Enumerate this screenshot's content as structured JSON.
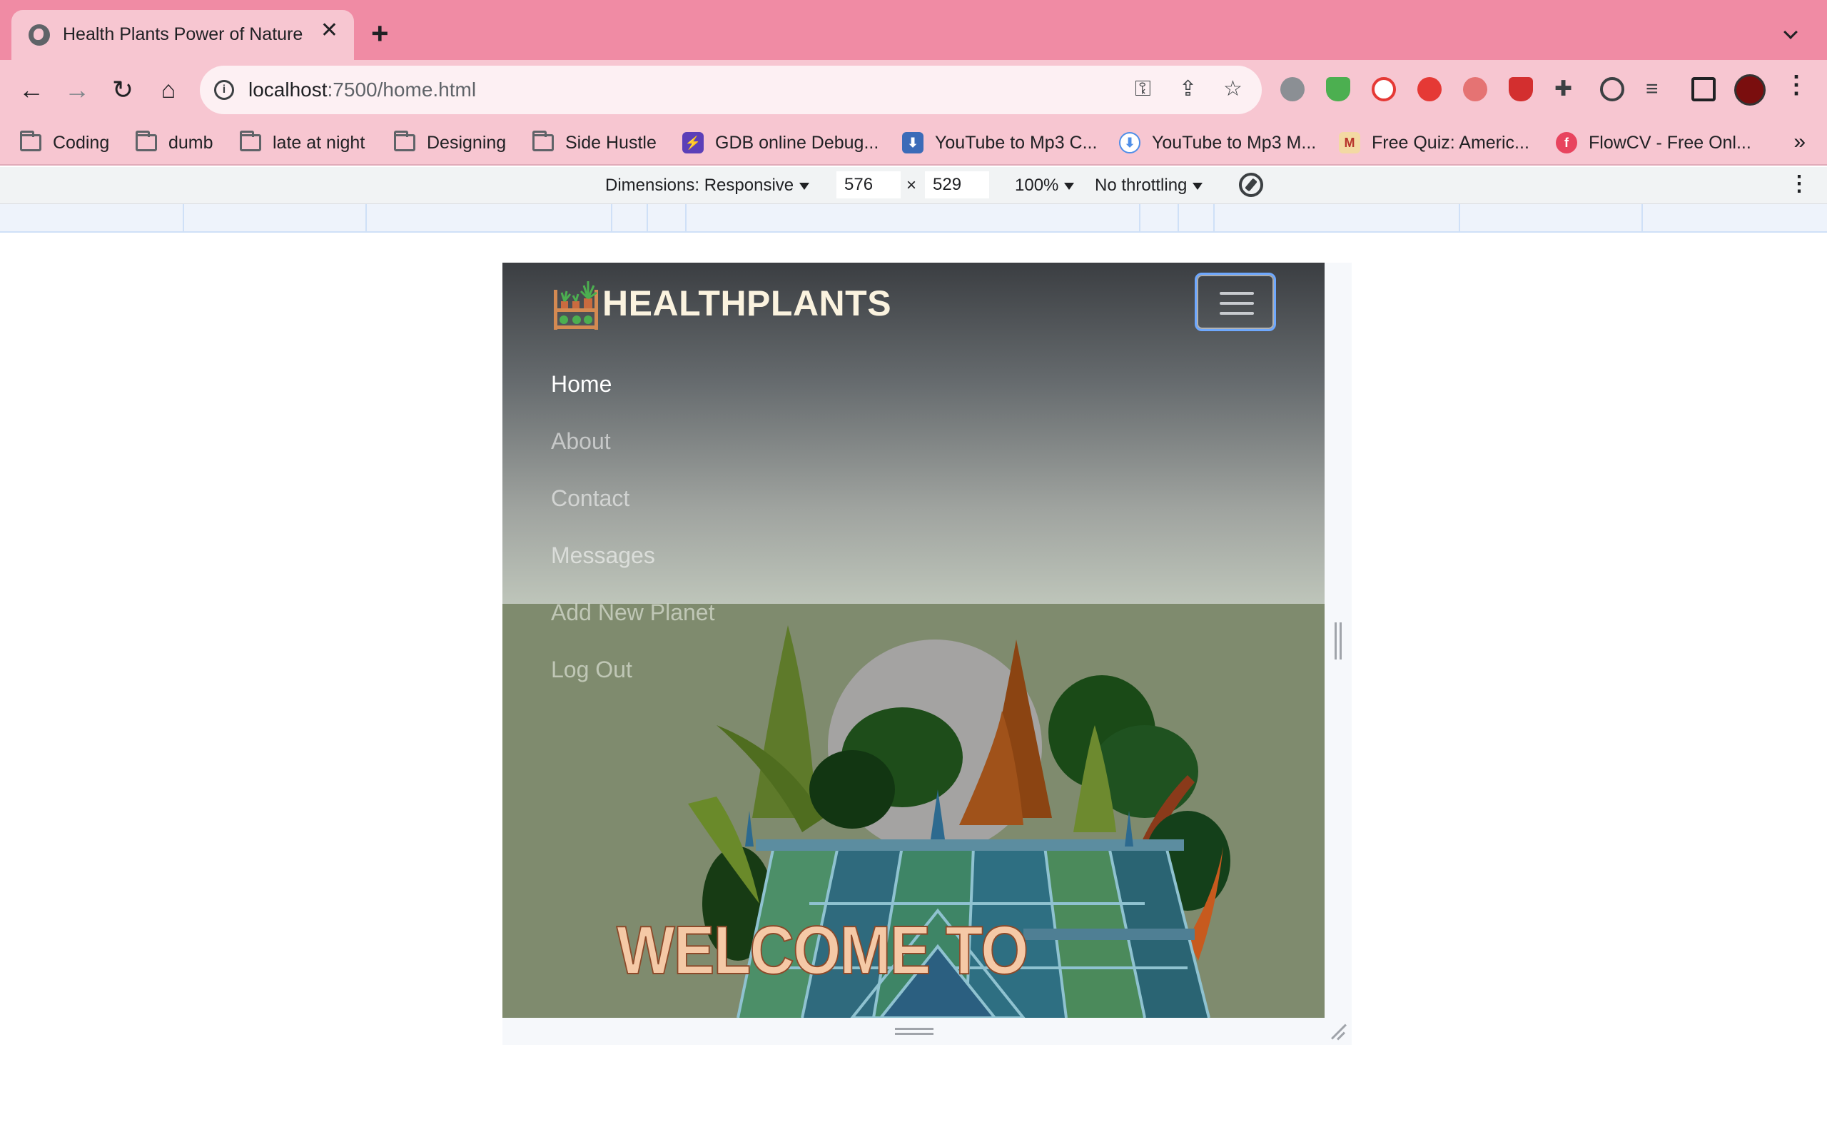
{
  "browser": {
    "tab": {
      "title": "Health Plants Power of Nature",
      "close": "✕"
    },
    "new_tab": "+",
    "address": {
      "host": "localhost",
      "path": ":7500/home.html"
    },
    "bookmarks": [
      {
        "label": "Coding",
        "icon": "folder-icon"
      },
      {
        "label": "dumb",
        "icon": "folder-icon"
      },
      {
        "label": "late at night",
        "icon": "folder-icon"
      },
      {
        "label": "Designing",
        "icon": "folder-icon"
      },
      {
        "label": "Side Hustle",
        "icon": "folder-icon"
      },
      {
        "label": "GDB online Debug...",
        "icon": "gdb-icon",
        "color": "#5b3fb8"
      },
      {
        "label": "YouTube to Mp3 C...",
        "icon": "download-icon",
        "color": "#3b6bb8"
      },
      {
        "label": "YouTube to Mp3 M...",
        "icon": "cloud-download-icon",
        "color": "#4f8ee8"
      },
      {
        "label": "Free Quiz: Americ...",
        "icon": "quiz-icon",
        "color": "#b8342c"
      },
      {
        "label": "FlowCV - Free Onl...",
        "icon": "flowcv-icon",
        "color": "#e8445e"
      }
    ],
    "bookmarks_more": "»"
  },
  "devtools": {
    "dimensions_label": "Dimensions: Responsive",
    "width": "576",
    "times": "×",
    "height": "529",
    "zoom": "100%",
    "throttling": "No throttling"
  },
  "site": {
    "brand": "HEALTHPLANTS",
    "nav": [
      "Home",
      "About",
      "Contact",
      "Messages",
      "Add New Planet",
      "Log Out"
    ],
    "hero_title": "WELCOME TO"
  },
  "colors": {
    "tabstrip": "#f08ba4",
    "toolbar": "#f7c6d1",
    "hero_bg": "#7f8b6e",
    "brand_text": "#fbf3df",
    "hero_title": "#f5c9a6"
  }
}
